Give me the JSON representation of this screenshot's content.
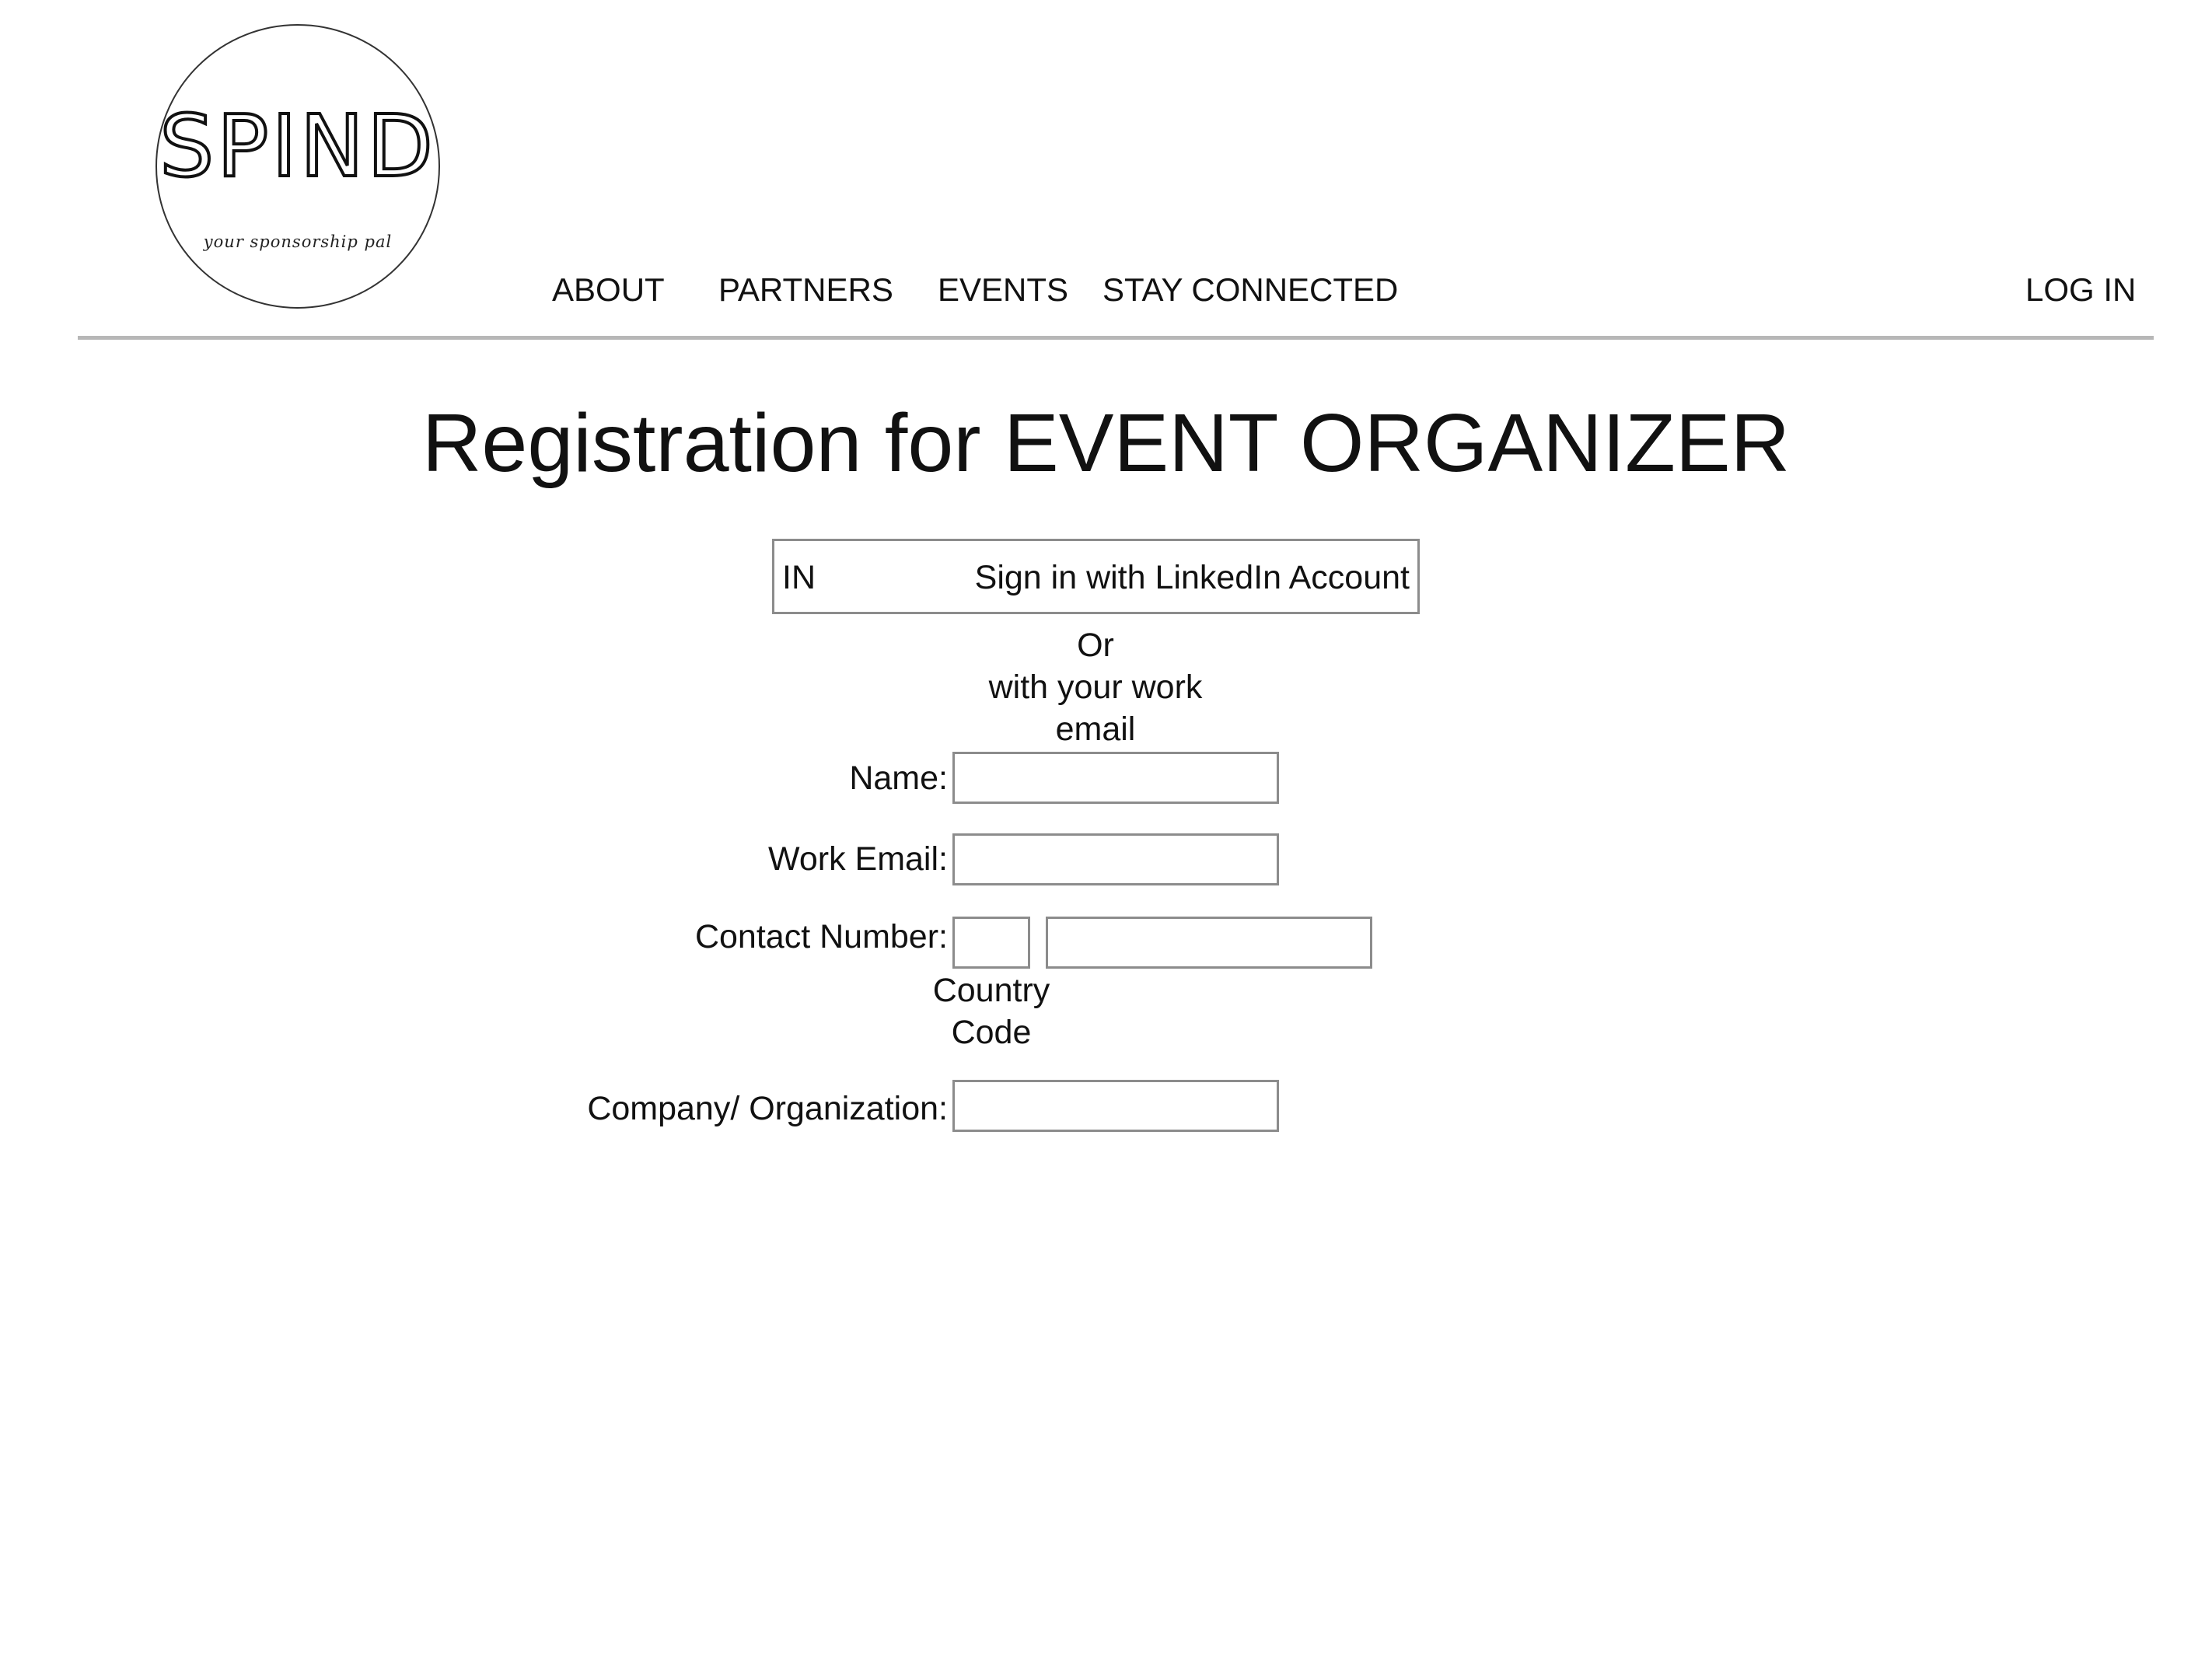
{
  "logo": {
    "wordmark": "SPIND",
    "tagline": "your sponsorship pal"
  },
  "nav": {
    "items": [
      {
        "label": "ABOUT"
      },
      {
        "label": "PARTNERS"
      },
      {
        "label": "EVENTS"
      },
      {
        "label": "STAY CONNECTED"
      }
    ],
    "login_label": "LOG IN"
  },
  "page": {
    "title": "Registration for EVENT ORGANIZER"
  },
  "linkedin": {
    "icon_text": "IN",
    "label": "Sign in with LinkedIn Account"
  },
  "separator": {
    "line1": "Or",
    "line2": "with your work",
    "line3": "email"
  },
  "form": {
    "name_label": "Name:",
    "name_value": "",
    "email_label": "Work Email:",
    "email_value": "",
    "contact_label": "Contact Number:",
    "country_code_value": "",
    "phone_value": "",
    "country_code_caption_line1": "Country",
    "country_code_caption_line2": "Code",
    "company_label": "Company/ Organization:",
    "company_value": ""
  }
}
